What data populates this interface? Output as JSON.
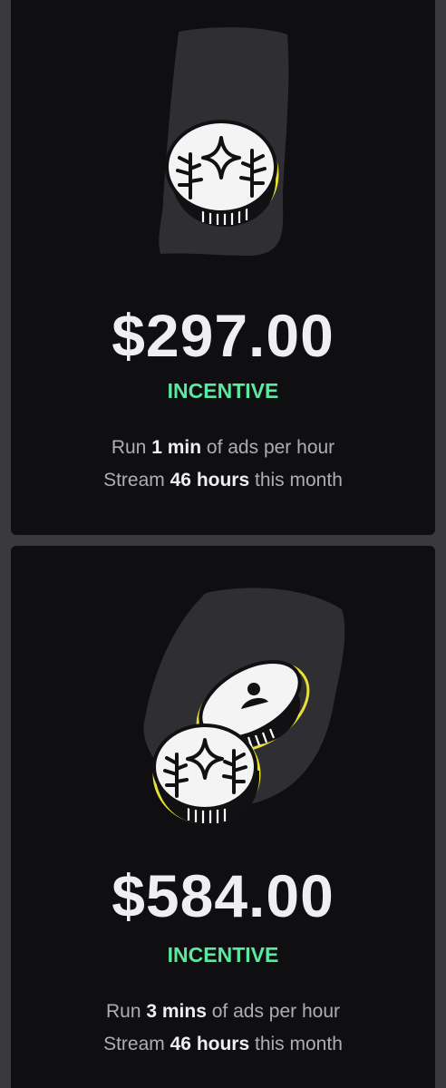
{
  "cards": [
    {
      "amount": "$297.00",
      "badge": "INCENTIVE",
      "line1": {
        "prefix": "Run",
        "bold": "1 min",
        "suffix": "of ads per hour"
      },
      "line2": {
        "prefix": "Stream",
        "bold": "46 hours",
        "suffix": "this month"
      },
      "illustration": "single-coin-icon"
    },
    {
      "amount": "$584.00",
      "badge": "INCENTIVE",
      "line1": {
        "prefix": "Run",
        "bold": "3 mins",
        "suffix": "of ads per hour"
      },
      "line2": {
        "prefix": "Stream",
        "bold": "46 hours",
        "suffix": "this month"
      },
      "illustration": "double-coin-icon"
    }
  ],
  "colors": {
    "background": "#3a3a3d",
    "card": "#0f0f11",
    "amount": "#efeff1",
    "badge": "#5ce8a0",
    "muted_text": "#adadb8",
    "coin_outline": "#e8e03a"
  }
}
